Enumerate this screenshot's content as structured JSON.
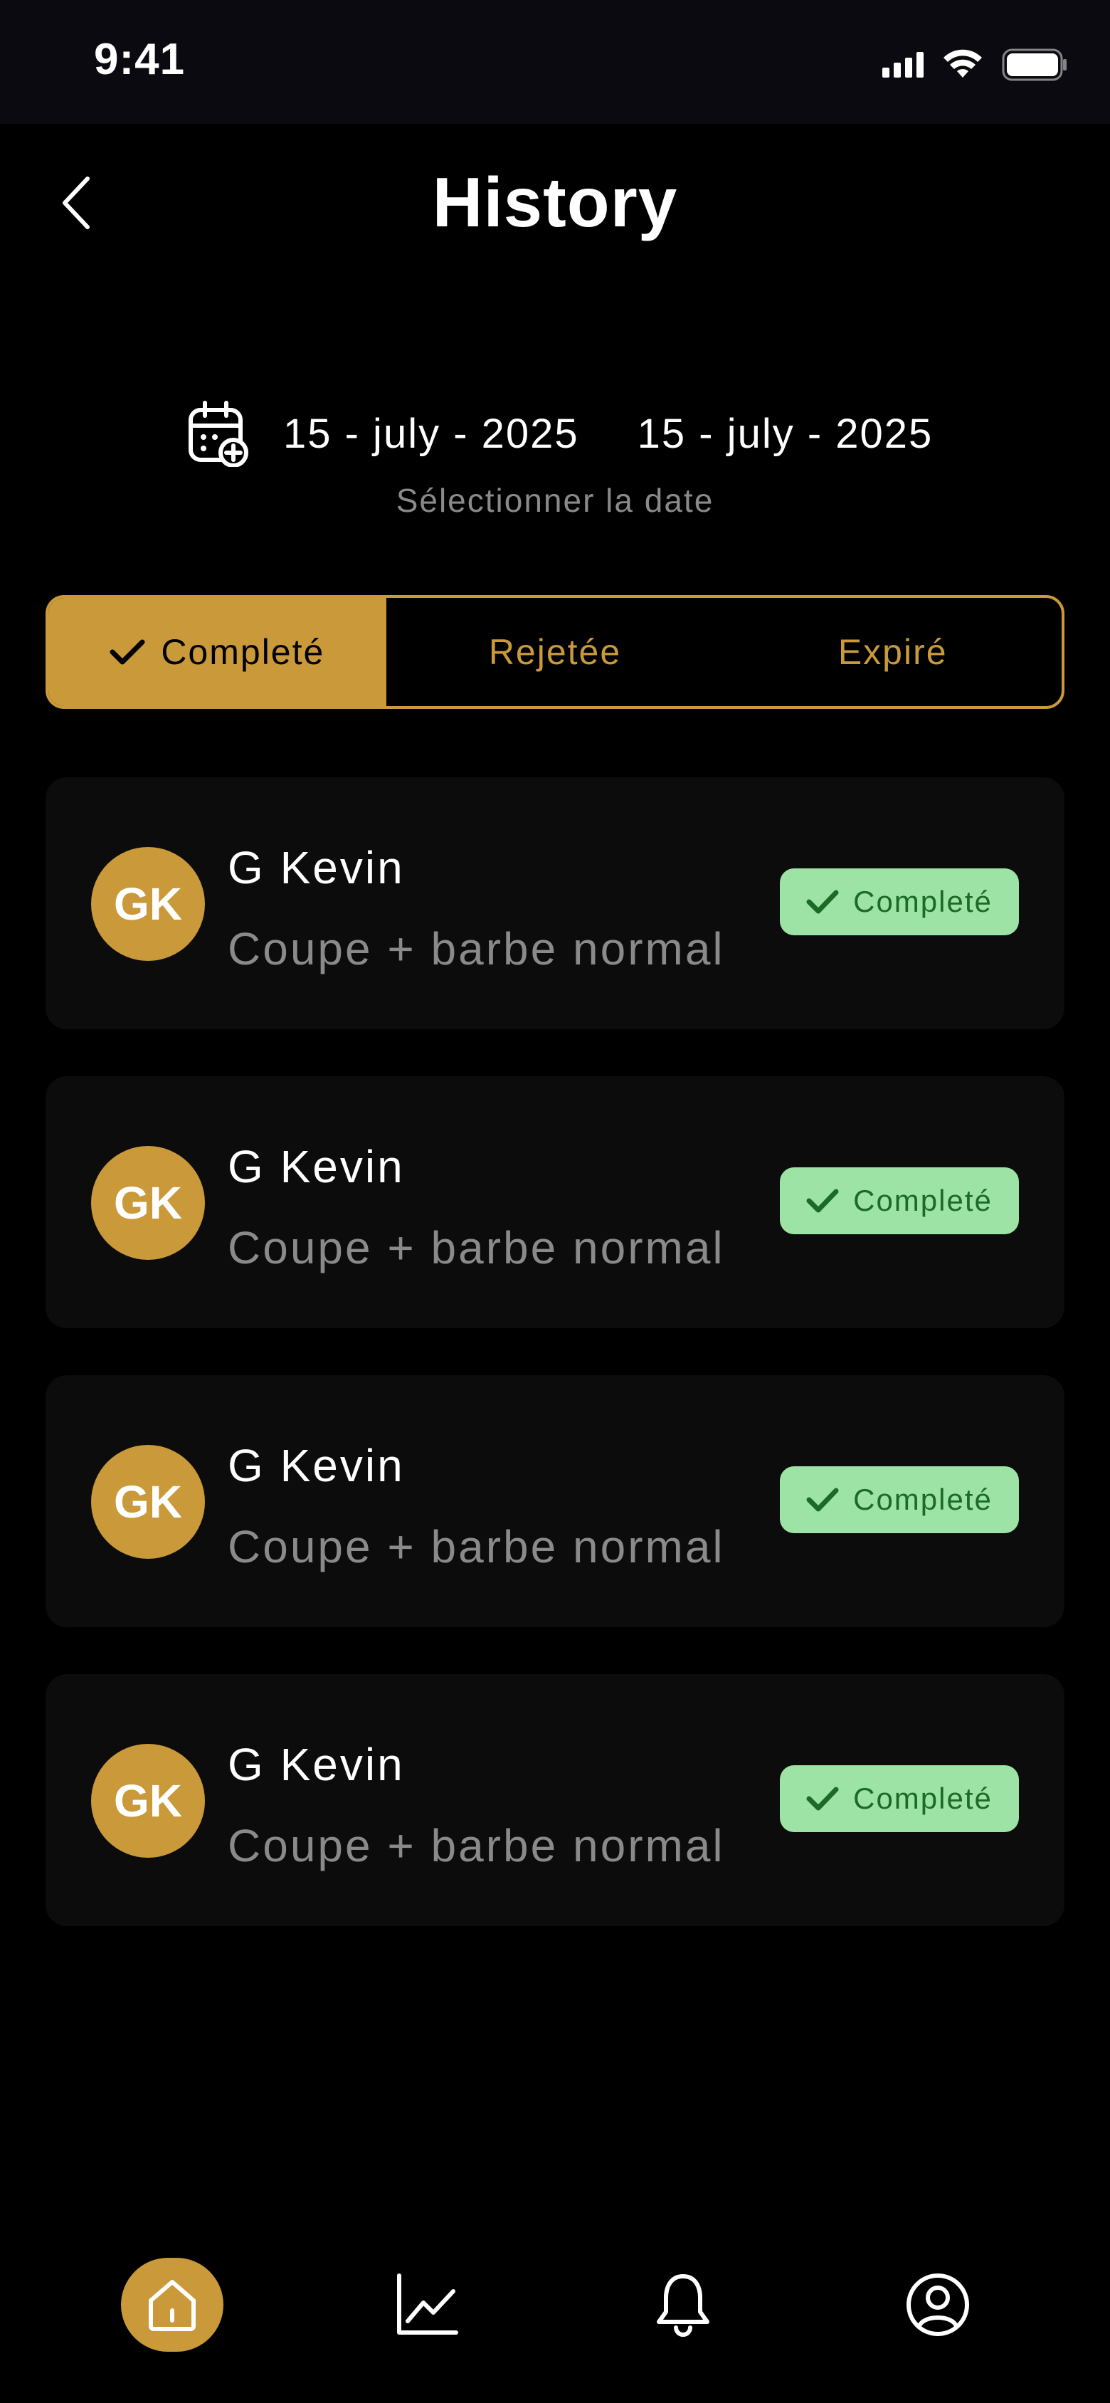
{
  "status_bar": {
    "time": "9:41"
  },
  "header": {
    "title": "History"
  },
  "date_filter": {
    "start_date": "15 - july - 2025",
    "end_date": "15 - july - 2025",
    "hint": "Sélectionner la date"
  },
  "tabs": [
    {
      "label": "Completé",
      "active": true
    },
    {
      "label": "Rejetée",
      "active": false
    },
    {
      "label": "Expiré",
      "active": false
    }
  ],
  "history": [
    {
      "initials": "GK",
      "name": "G Kevin",
      "service": "Coupe + barbe normal",
      "status": "Completé"
    },
    {
      "initials": "GK",
      "name": "G Kevin",
      "service": "Coupe + barbe normal",
      "status": "Completé"
    },
    {
      "initials": "GK",
      "name": "G Kevin",
      "service": "Coupe + barbe normal",
      "status": "Completé"
    },
    {
      "initials": "GK",
      "name": "G Kevin",
      "service": "Coupe + barbe normal",
      "status": "Completé"
    }
  ],
  "bottom_nav": [
    {
      "icon": "home-icon",
      "active": true
    },
    {
      "icon": "chart-icon",
      "active": false
    },
    {
      "icon": "bell-icon",
      "active": false
    },
    {
      "icon": "profile-icon",
      "active": false
    }
  ],
  "colors": {
    "accent": "#c9993a",
    "badge_bg": "#9de3a6",
    "badge_text": "#1b6b26",
    "muted": "#8a8a8a"
  }
}
